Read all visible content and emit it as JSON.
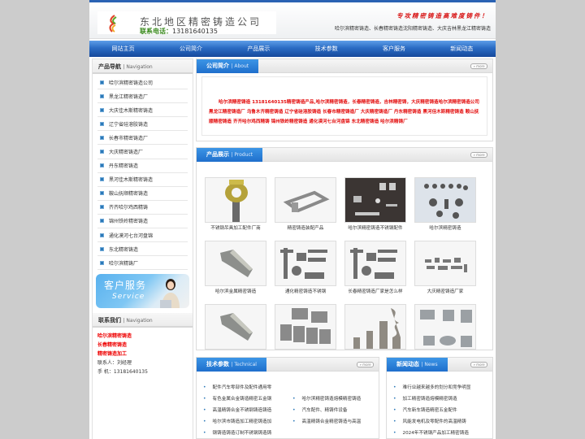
{
  "header": {
    "company_name": "东北地区精密铸造公司",
    "phone_label": "联系电话：",
    "phone": "13181640135",
    "slogan": "专攻精密铸造高难度铸件！",
    "subtitle": "哈尔滨精密铸造、长春精密铸造沈阳精密铸造、大庆吉林黑龙江精密铸造"
  },
  "nav": {
    "items": [
      "网站主页",
      "公司简介",
      "产品展示",
      "技术参数",
      "客户服务",
      "新闻动态"
    ]
  },
  "left": {
    "nav_title": "产品导航",
    "nav_title_en": "Navigation",
    "items": [
      "哈尔滨精密铸造公司",
      "黑龙江精密铸造厂",
      "大庆佳木斯精密铸造",
      "辽宁省硅溶胶铸造",
      "长春市精密铸造厂",
      "大庆精密铸造厂",
      "丹东精密铸造",
      "黑河佳木斯精密铸造",
      "鞍山抚顺精密铸造",
      "齐齐哈尔鸡西精铸",
      "锦州铁岭精密铸造",
      "通化漠河七台河盘锦",
      "东北精密铸造",
      "哈尔滨精铸厂"
    ],
    "service_banner": {
      "cn": "客户服务",
      "en": "Service"
    },
    "contact_title": "联系我们",
    "contact_title_en": "Navigation",
    "contact_links": [
      "哈尔滨精密铸造",
      "长春精密铸造",
      "精密铸造加工"
    ],
    "contact_person": "联系人：刘经理",
    "contact_mobile": "手 机：13181640135"
  },
  "about": {
    "title": "公司简介",
    "title_en": "About",
    "more": "» more",
    "text": "哈尔滨精密铸造 13181640135精密铸造产品,哈尔滨精密铸造，长春精密铸造，吉林精密铸，大庆精密铸造哈尔滨精密铸造公司 黑龙江精密铸造厂 乌鲁木齐精密铸造 辽宁省硅溶胶铸造 长春市精密铸造厂 大庆精密铸造厂 丹东精密铸造 黑河佳木斯精密铸造 鞍山抚顺精密铸造 齐齐哈尔鸡西精铸 锦州铁岭精密铸造 通化漠河七台河盘锦 东北精密铸造 哈尔滨精铸厂"
  },
  "products": {
    "title": "产品展示",
    "title_en": "Product",
    "more": "» more",
    "items": [
      {
        "caption": "不锈钢吊具加工配件厂商",
        "image": "brass-lifting-eye"
      },
      {
        "caption": "精密铸造装配产品",
        "image": "steel-frame-bracket"
      },
      {
        "caption": "哈尔滨精密铸造不锈钢配件",
        "image": "assorted-steel-parts"
      },
      {
        "caption": "哈尔滨精密铸造",
        "image": "steel-clamps"
      },
      {
        "caption": "哈尔滨金属精密铸造",
        "image": "cast-nozzle"
      },
      {
        "caption": "通化精密铸造不锈钢",
        "image": "cast-levers"
      },
      {
        "caption": "长春精密铸造厂家是怎么样",
        "image": "cast-levers"
      },
      {
        "caption": "大庆精密铸造厂家",
        "image": "small-parts"
      },
      {
        "caption": "",
        "image": "cast-nozzle"
      },
      {
        "caption": "",
        "image": "cast-plates"
      },
      {
        "caption": "",
        "image": "spiral-nozzles"
      },
      {
        "caption": "",
        "image": "cast-brackets"
      }
    ]
  },
  "tech": {
    "title": "技术参数",
    "title_en": "Technical",
    "more": "» more",
    "items": [
      "配件汽车零部件及配件通用零",
      "",
      "有色金属合金铸造精密五金钢",
      "哈尔滨精密铸造熔模精密铸造",
      "高温精铸合金不锈钢铸造铸造",
      "汽车配件、精铸件设备",
      "哈尔滨市铸造加工精密铸造加",
      "高温精铸合金精密铸造与高温",
      "钢铸造铸造订制不锈钢铸造铸",
      ""
    ]
  },
  "news": {
    "title": "新闻动态",
    "title_en": "News",
    "more": "» more",
    "items": [
      "难行业越来越多的划分和竞争明显",
      "加工精密铸造熔模精密铸造",
      "汽车新车铸造精密五金配件",
      "风能发电机及零配件的高温精铸",
      "2024年不锈钢产品加工精密铸造"
    ]
  },
  "colors": {
    "page_bg": "#cccccc",
    "nav_blue": "#2b6cc4",
    "accent_red": "#e30d0d",
    "tab_blue": "#1f6fcc"
  }
}
